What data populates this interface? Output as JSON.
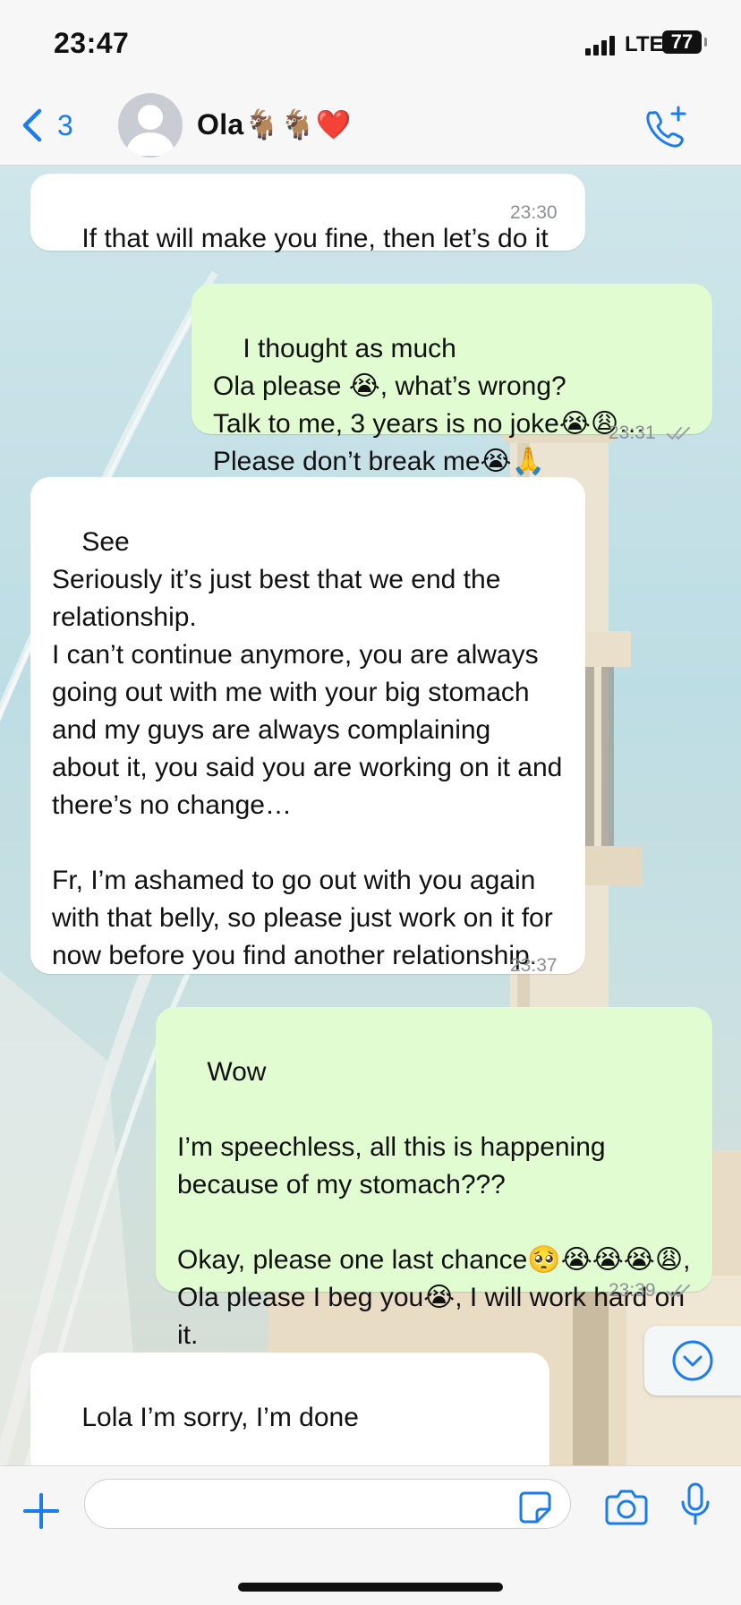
{
  "status_bar": {
    "time": "23:47",
    "network": "LTE",
    "battery": "77"
  },
  "header": {
    "back_count": "3",
    "contact_name": "Ola🐐🐐❤️"
  },
  "colors": {
    "accent": "#1b7cf0",
    "incoming_bubble": "#ffffff",
    "outgoing_bubble": "#e2fcd2",
    "timestamp": "#8b8f95"
  },
  "messages": [
    {
      "direction": "incoming",
      "text": "If that will make you fine, then let’s do it",
      "time": "23:30"
    },
    {
      "direction": "outgoing",
      "text": "I thought as much\nOla please 😭, what’s wrong?\nTalk to me, 3 years is no joke😭😩…\nPlease don’t break me😭🙏",
      "time": "23:31",
      "status": "read"
    },
    {
      "direction": "incoming",
      "text": "See\nSeriously it’s just best that we end the relationship.\nI can’t continue anymore, you are always going out with me with your big stomach and my guys are always complaining about it, you said you are working on it and there’s no change…\n\nFr, I’m ashamed to go out with you again with that belly, so please just work on it for now before you find another relationship.",
      "time": "23:37"
    },
    {
      "direction": "outgoing",
      "text": "Wow\n\nI’m speechless, all this is happening because of my stomach???\n\nOkay, please one last chance🥺😭😭😭😩, Ola please I beg you😭, I will work hard on it.",
      "time": "23:39",
      "status": "read"
    },
    {
      "direction": "incoming",
      "text": "Lola I’m sorry, I’m done\n\nIt can’t work again. Have a nice life!",
      "time": ""
    }
  ],
  "input": {
    "placeholder": "",
    "value": ""
  },
  "icons": [
    "chevron-left-icon",
    "avatar-placeholder-icon",
    "phone-add-icon",
    "plus-icon",
    "sticker-icon",
    "camera-icon",
    "microphone-icon",
    "chevron-down-circle-icon",
    "double-check-icon"
  ]
}
